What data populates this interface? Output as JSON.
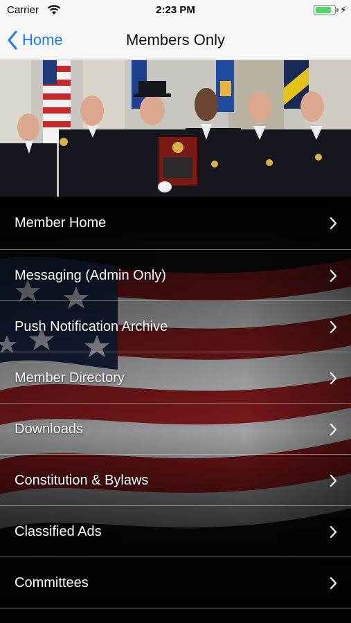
{
  "status_bar": {
    "carrier": "Carrier",
    "time": "2:23 PM",
    "battery_level": 0.85,
    "charging_symbol": "⚡"
  },
  "nav": {
    "back_label": "Home",
    "title": "Members Only",
    "accent_color": "#1a7cf5"
  },
  "hero": {
    "icon": "group-photo-with-plaque"
  },
  "menu": {
    "items": [
      {
        "label": "Member Home"
      },
      {
        "label": "Messaging (Admin Only)"
      },
      {
        "label": "Push Notification Archive"
      },
      {
        "label": "Member Directory"
      },
      {
        "label": "Downloads"
      },
      {
        "label": "Constitution & Bylaws"
      },
      {
        "label": "Classified Ads"
      },
      {
        "label": "Committees"
      }
    ]
  }
}
